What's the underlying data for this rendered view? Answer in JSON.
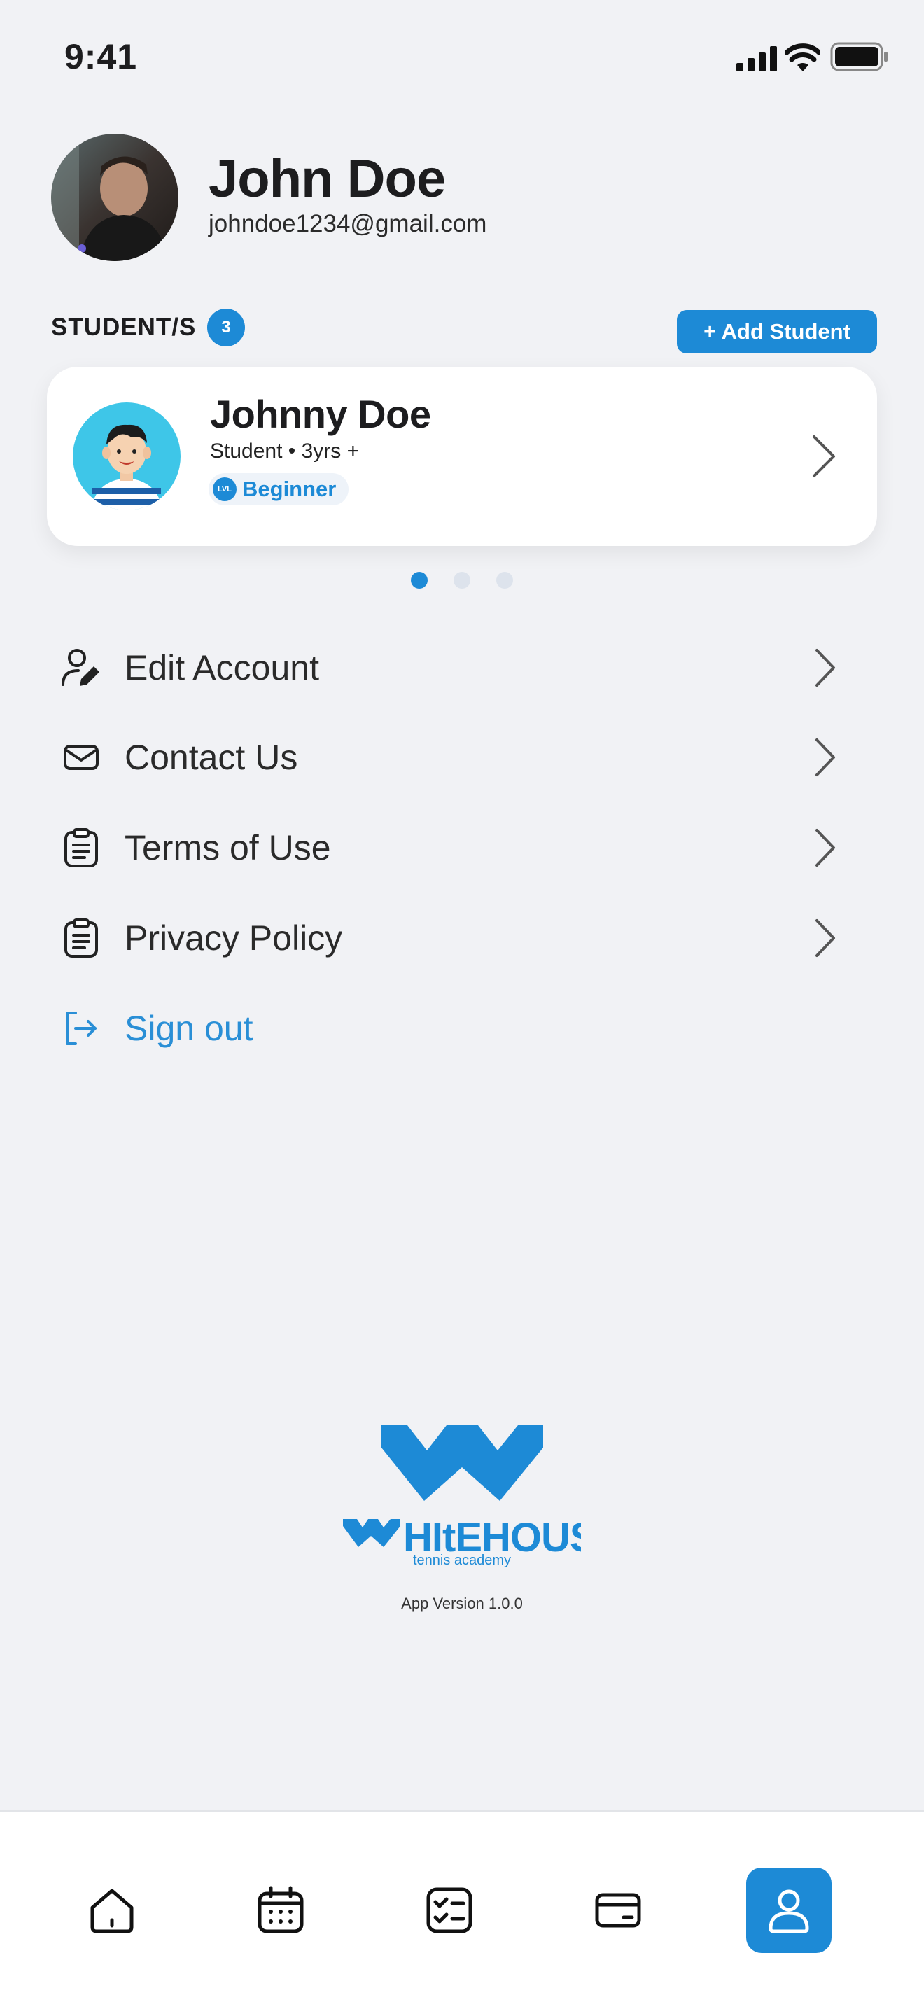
{
  "status_bar": {
    "time": "9:41"
  },
  "profile": {
    "name": "John Doe",
    "email": "johndoe1234@gmail.com"
  },
  "students": {
    "label": "STUDENT/S",
    "count": "3",
    "add_button": "+ Add Student",
    "card": {
      "name": "Johnny Doe",
      "meta": "Student • 3yrs +",
      "level_badge": "LVL",
      "level": "Beginner"
    },
    "pagination": {
      "pages": 3,
      "active": 1
    }
  },
  "menu": [
    {
      "label": "Edit Account",
      "icon": "user-edit-icon"
    },
    {
      "label": "Contact Us",
      "icon": "mail-icon"
    },
    {
      "label": "Terms of Use",
      "icon": "clipboard-icon"
    },
    {
      "label": "Privacy Policy",
      "icon": "clipboard-icon"
    }
  ],
  "sign_out": {
    "label": "Sign out",
    "icon": "logout-icon"
  },
  "brand": {
    "logo_text": "WHITEHOUSE",
    "tagline": "tennis academy",
    "app_version": "App Version 1.0.0"
  },
  "tabbar": {
    "tabs": [
      "home-icon",
      "calendar-icon",
      "checklist-icon",
      "card-icon",
      "profile-icon"
    ],
    "active": "profile-icon"
  },
  "colors": {
    "accent": "#1d8ad6",
    "background": "#f1f2f5",
    "text": "#1d1d1f"
  }
}
